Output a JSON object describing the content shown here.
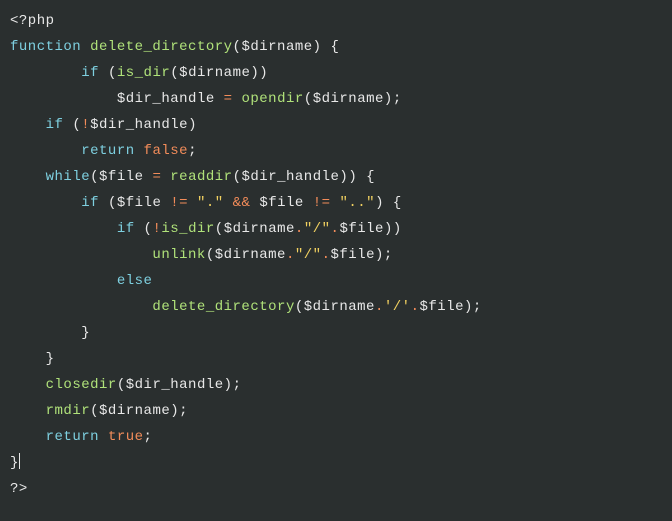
{
  "code": {
    "open_tag": "<?php",
    "close_tag": "?>",
    "kw_function": "function",
    "kw_if": "if",
    "kw_while": "while",
    "kw_else": "else",
    "kw_return": "return",
    "fn_delete_directory": "delete_directory",
    "fn_is_dir": "is_dir",
    "fn_opendir": "opendir",
    "fn_readdir": "readdir",
    "fn_unlink": "unlink",
    "fn_closedir": "closedir",
    "fn_rmdir": "rmdir",
    "var_dirname": "$dirname",
    "var_dir_handle": "$dir_handle",
    "var_file": "$file",
    "bool_false": "false",
    "bool_true": "true",
    "str_dot": "\".\"",
    "str_dotdot": "\"..\"",
    "str_slash_dq": "\"/\"",
    "str_slash_sq": "'/'",
    "op_assign": "=",
    "op_neq": "!=",
    "op_and": "&&",
    "op_not": "!",
    "op_concat": ".",
    "lparen": "(",
    "rparen": ")",
    "lbrace": "{",
    "rbrace": "}",
    "semi": ";"
  }
}
